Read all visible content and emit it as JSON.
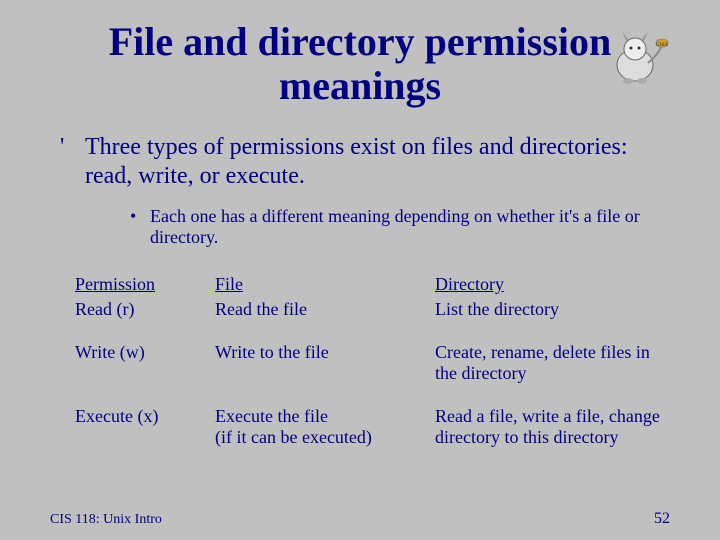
{
  "title": "File and directory permission meanings",
  "bullet_main": "Three types of permissions exist on files and directories: read, write, or execute.",
  "bullet_sub": "Each one has a different meaning depending on whether it's a file or directory.",
  "table": {
    "headers": {
      "col1": "Permission",
      "col2": "File",
      "col3": "Directory"
    },
    "rows": [
      {
        "col1": "Read (r)",
        "col2": "Read the file",
        "col3": "List the directory"
      },
      {
        "col1": "Write (w)",
        "col2": "Write to the file",
        "col3": "Create, rename, delete files in the directory"
      },
      {
        "col1": "Execute (x)",
        "col2": "Execute the file\n(if it can be executed)",
        "col3": "Read a file, write a file, change directory to this directory"
      }
    ]
  },
  "footer": {
    "left": "CIS 118: Unix Intro",
    "right": "52"
  }
}
